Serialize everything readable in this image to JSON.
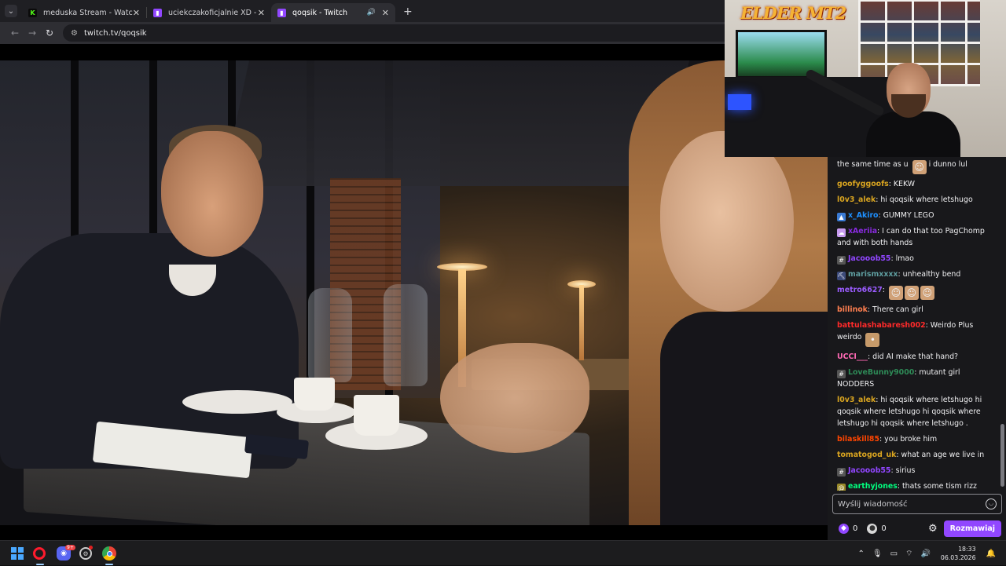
{
  "browser": {
    "tabs": [
      {
        "title": "meduska Stream - Watch Live o",
        "favicon": "K",
        "active": false
      },
      {
        "title": "uciekczakoficjalnie XD - Twitch",
        "favicon": "twitch",
        "active": false
      },
      {
        "title": "qoqsik - Twitch",
        "favicon": "twitch",
        "active": true
      }
    ],
    "new_tab": "+",
    "url": "twitch.tv/qoqsik"
  },
  "facecam": {
    "logo": "ELDER MT2"
  },
  "chat": {
    "messages": [
      {
        "user": "",
        "text": "the same time as u",
        "tail": "i dunno lul",
        "color": "#efeff1"
      },
      {
        "user": "goofyggoofs",
        "text": ": KEKW",
        "color": "#daa520"
      },
      {
        "user": "l0v3_alek",
        "text": ": hi qoqsik where letshugo",
        "color": "#daa520"
      },
      {
        "user": "x_Akiro",
        "text": ": GUMMY LEGO",
        "color": "#1e90ff"
      },
      {
        "user": "xAeriia",
        "text": ": I can do that too PagChomp and with both hands",
        "color": "#8a2be2"
      },
      {
        "user": "Jacooob55",
        "text": ": lmao",
        "color": "#9146ff"
      },
      {
        "user": "marismxxxx",
        "text": ": unhealthy bend",
        "color": "#5f9ea0"
      },
      {
        "user": "metro6627",
        "text": ":",
        "color": "#9b5cff"
      },
      {
        "user": "billinok",
        "text": ": There can girl",
        "color": "#ff7f50"
      },
      {
        "user": "battulashabaresh002",
        "text": ": Weirdo Plus weirdo",
        "color": "#ff2a2a"
      },
      {
        "user": "UCCI___",
        "text": ": did AI make that hand?",
        "color": "#ff69b4"
      },
      {
        "user": "LoveBunny9000",
        "text": ": mutant girl NODDERS",
        "color": "#2e8b57"
      },
      {
        "user": "l0v3_alek",
        "text": ": hi qoqsik where letshugo hi qoqsik where letshugo hi qoqsik where letshugo hi qoqsik where letshugo .",
        "color": "#daa520"
      },
      {
        "user": "bilaskill85",
        "text": ": you broke him",
        "color": "#ff4500"
      },
      {
        "user": "tomatogod_uk",
        "text": ": what an age we live in",
        "color": "#daa520"
      },
      {
        "user": "Jacooob55",
        "text": ": sirius",
        "color": "#9146ff"
      },
      {
        "user": "earthyjones",
        "text": ": thats some tism rizz",
        "color": "#00ff7f"
      },
      {
        "user": "metro6627",
        "text": ":",
        "color": "#9b5cff"
      }
    ],
    "input_placeholder": "Wyślij wiadomość",
    "points_1": "0",
    "points_2": "0",
    "chat_button": "Rozmawiaj"
  },
  "taskbar": {
    "time": "18:33",
    "date": "06.03.2026",
    "discord_badge": "9+"
  },
  "colors": {
    "twitch_purple": "#9147ff",
    "chat_bg": "#18181b",
    "taskbar_bg": "#1c1c1e"
  }
}
